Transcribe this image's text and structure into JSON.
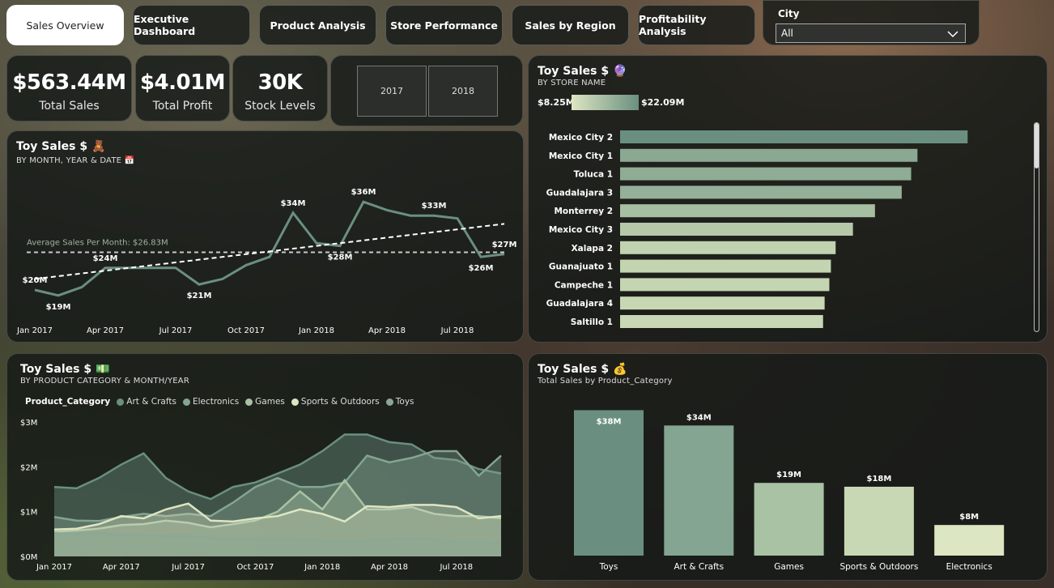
{
  "tabs": [
    {
      "label": "Sales Overview",
      "active": true
    },
    {
      "label": "Executive Dashboard"
    },
    {
      "label": "Product Analysis"
    },
    {
      "label": "Store Performance"
    },
    {
      "label": "Sales by Region"
    },
    {
      "label": "Profitability Analysis"
    }
  ],
  "slicer": {
    "label": "City",
    "value": "All"
  },
  "kpis": [
    {
      "value": "$563.44M",
      "label": "Total Sales"
    },
    {
      "value": "$4.01M",
      "label": "Total Profit"
    },
    {
      "value": "30K",
      "label": "Stock Levels"
    }
  ],
  "years": [
    "2017",
    "2018"
  ],
  "line_panel": {
    "title": "Toy Sales $",
    "emoji": "🧸",
    "subtitle": "BY MONTH, YEAR & DATE",
    "sub_emoji": "📅",
    "avg_label": "Average Sales Per Month: $26.83M"
  },
  "store_panel": {
    "title": "Toy Sales $",
    "emoji": "🔮",
    "subtitle": "BY STORE NAME",
    "min_label": "$8.25M",
    "max_label": "$22.09M"
  },
  "area_panel": {
    "title": "Toy Sales $",
    "emoji": "💵",
    "subtitle": "BY PRODUCT CATEGORY & MONTH/YEAR",
    "legend_title": "Product_Category"
  },
  "cat_panel": {
    "title": "Toy Sales $",
    "emoji": "💰",
    "subtitle": "Total Sales by Product_Category"
  },
  "colors": {
    "dark": "#6a8f80",
    "mid": "#84a592",
    "light": "#a9c2a4",
    "pale": "#c8d8b4",
    "palest": "#dde6c2"
  },
  "chart_data": [
    {
      "type": "line",
      "title": "Toy Sales $",
      "x": [
        "Jan 2017",
        "Feb 2017",
        "Mar 2017",
        "Apr 2017",
        "May 2017",
        "Jun 2017",
        "Jul 2017",
        "Aug 2017",
        "Sep 2017",
        "Oct 2017",
        "Nov 2017",
        "Dec 2017",
        "Jan 2018",
        "Feb 2018",
        "Mar 2018",
        "Apr 2018",
        "May 2018",
        "Jun 2018",
        "Jul 2018",
        "Aug 2018",
        "Sep 2018"
      ],
      "x_ticks": [
        "Jan 2017",
        "Apr 2017",
        "Jul 2017",
        "Oct 2017",
        "Jan 2018",
        "Apr 2018",
        "Jul 2018"
      ],
      "values": [
        20,
        19,
        20.5,
        24,
        24,
        24,
        24,
        21,
        22,
        24.5,
        26,
        34,
        28.5,
        28,
        36,
        34.5,
        33.5,
        33.5,
        33,
        26,
        26.5
      ],
      "data_labels": [
        {
          "i": 0,
          "text": "$20M",
          "pos": "above"
        },
        {
          "i": 1,
          "text": "$19M",
          "pos": "below"
        },
        {
          "i": 3,
          "text": "$24M",
          "pos": "above"
        },
        {
          "i": 7,
          "text": "$21M",
          "pos": "below"
        },
        {
          "i": 11,
          "text": "$34M",
          "pos": "above"
        },
        {
          "i": 13,
          "text": "$28M",
          "pos": "below"
        },
        {
          "i": 14,
          "text": "$36M",
          "pos": "above"
        },
        {
          "i": 17,
          "text": "$33M",
          "pos": "above"
        },
        {
          "i": 19,
          "text": "$26M",
          "pos": "below"
        },
        {
          "i": 20,
          "text": "$27M",
          "pos": "above"
        }
      ],
      "average": 26.83,
      "trend": [
        22,
        32
      ],
      "ylim": [
        15,
        40
      ]
    },
    {
      "type": "bar",
      "orientation": "horizontal",
      "title": "Toy Sales $",
      "categories": [
        "Mexico City 2",
        "Mexico City 1",
        "Toluca 1",
        "Guadalajara 3",
        "Monterrey 2",
        "Mexico City 3",
        "Xalapa 2",
        "Guanajuato 1",
        "Campeche 1",
        "Guadalajara 4",
        "Saltillo 1"
      ],
      "values": [
        22.09,
        18.9,
        18.5,
        17.9,
        16.2,
        14.8,
        13.7,
        13.4,
        13.3,
        13.0,
        12.9
      ],
      "xlim": [
        0,
        23
      ]
    },
    {
      "type": "area",
      "title": "Toy Sales $",
      "x_ticks": [
        "Jan 2017",
        "Apr 2017",
        "Jul 2017",
        "Oct 2017",
        "Jan 2018",
        "Apr 2018",
        "Jul 2018"
      ],
      "y_ticks": [
        "$0M",
        "$1M",
        "$2M",
        "$3M"
      ],
      "ylim": [
        0,
        3
      ],
      "series": [
        {
          "name": "Art & Crafts",
          "values": [
            1.55,
            1.52,
            1.75,
            2.05,
            2.3,
            1.75,
            1.45,
            1.28,
            1.55,
            1.65,
            1.85,
            2.05,
            2.35,
            2.72,
            2.72,
            2.55,
            2.5,
            2.2,
            2.15,
            1.95,
            1.85
          ]
        },
        {
          "name": "Electronics",
          "values": [
            0.88,
            0.8,
            0.79,
            0.88,
            0.95,
            0.9,
            0.95,
            0.9,
            1.2,
            1.55,
            1.75,
            1.55,
            1.55,
            1.65,
            2.25,
            2.1,
            2.2,
            2.35,
            2.35,
            1.8,
            2.25
          ]
        },
        {
          "name": "Games",
          "values": [
            0.55,
            0.58,
            0.62,
            0.7,
            0.72,
            0.8,
            0.75,
            0.65,
            0.72,
            0.8,
            1.0,
            1.45,
            1.05,
            1.7,
            1.05,
            1.05,
            1.1,
            0.95,
            0.9,
            0.9,
            0.85
          ]
        },
        {
          "name": "Sports & Outdoors",
          "values": [
            0.6,
            0.62,
            0.72,
            0.9,
            0.85,
            1.05,
            1.18,
            0.8,
            0.78,
            0.85,
            0.9,
            1.05,
            0.95,
            0.78,
            1.12,
            1.1,
            1.15,
            1.15,
            1.1,
            0.85,
            0.9
          ]
        },
        {
          "name": "Toys",
          "values": [
            0.52,
            0.5,
            0.52,
            0.48,
            0.48,
            0.45,
            0.45,
            0.42,
            0.38,
            0.38,
            0.38,
            0.38,
            0.35,
            0.35,
            0.35,
            0.38,
            0.4,
            0.38,
            0.32,
            0.32,
            0.3
          ]
        }
      ]
    },
    {
      "type": "bar",
      "title": "Toy Sales $",
      "categories": [
        "Toys",
        "Art & Crafts",
        "Games",
        "Sports & Outdoors",
        "Electronics"
      ],
      "values": [
        38,
        34,
        19,
        18,
        8
      ],
      "data_labels": [
        "$38M",
        "$34M",
        "$19M",
        "$18M",
        "$8M"
      ],
      "ylim": [
        0,
        40
      ]
    }
  ]
}
